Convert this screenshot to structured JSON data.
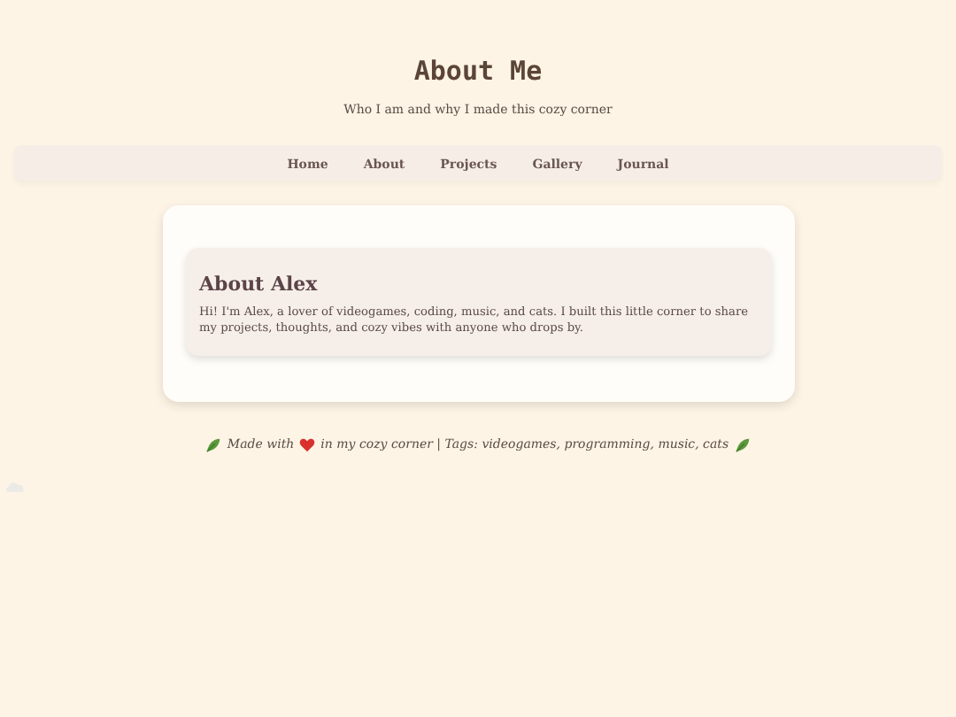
{
  "header": {
    "title": "About Me",
    "subtitle": "Who I am and why I made this cozy corner"
  },
  "nav": [
    {
      "label": "Home"
    },
    {
      "label": "About"
    },
    {
      "label": "Projects"
    },
    {
      "label": "Gallery"
    },
    {
      "label": "Journal"
    }
  ],
  "section": {
    "heading": "About Alex",
    "text": "Hi! I'm Alex, a lover of videogames, coding, music, and cats. I built this little corner to share my projects, thoughts, and cozy vibes with anyone who drops by."
  },
  "footer": {
    "before": "Made with",
    "after": "in my cozy corner | Tags: videogames, programming, music, cats"
  }
}
